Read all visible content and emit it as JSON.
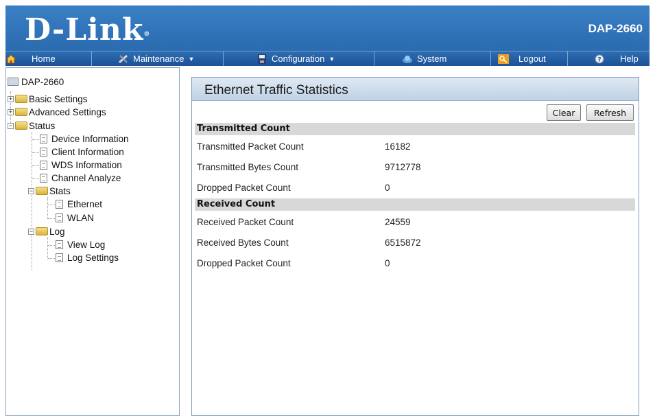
{
  "header": {
    "brand": "D-Link",
    "model": "DAP-2660"
  },
  "menu": [
    {
      "label": "Home",
      "icon": "home-icon",
      "has_dropdown": false
    },
    {
      "label": "Maintenance",
      "icon": "tools-icon",
      "has_dropdown": true
    },
    {
      "label": "Configuration",
      "icon": "floppy-disk-icon",
      "has_dropdown": true
    },
    {
      "label": "System",
      "icon": "system-icon",
      "has_dropdown": false
    },
    {
      "label": "Logout",
      "icon": "key-icon",
      "has_dropdown": false
    },
    {
      "label": "Help",
      "icon": "help-icon",
      "has_dropdown": false
    }
  ],
  "tree": {
    "root": "DAP-2660",
    "basic_settings": "Basic Settings",
    "advanced_settings": "Advanced Settings",
    "status": "Status",
    "device_information": "Device Information",
    "client_information": "Client Information",
    "wds_information": "WDS Information",
    "channel_analyze": "Channel Analyze",
    "stats": "Stats",
    "ethernet": "Ethernet",
    "wlan": "WLAN",
    "log": "Log",
    "view_log": "View Log",
    "log_settings": "Log Settings"
  },
  "panel": {
    "title": "Ethernet Traffic Statistics",
    "clear_label": "Clear",
    "refresh_label": "Refresh",
    "transmitted": {
      "heading": "Transmitted Count",
      "rows": [
        {
          "label": "Transmitted Packet Count",
          "value": "16182"
        },
        {
          "label": "Transmitted Bytes Count",
          "value": "9712778"
        },
        {
          "label": "Dropped Packet Count",
          "value": "0"
        }
      ]
    },
    "received": {
      "heading": "Received Count",
      "rows": [
        {
          "label": "Received Packet Count",
          "value": "24559"
        },
        {
          "label": "Received Bytes Count",
          "value": "6515872"
        },
        {
          "label": "Dropped Packet Count",
          "value": "0"
        }
      ]
    }
  },
  "colors": {
    "header_blue": "#2b6bb0",
    "menubar_blue": "#1d5196",
    "section_gray": "#d8d8d8"
  }
}
